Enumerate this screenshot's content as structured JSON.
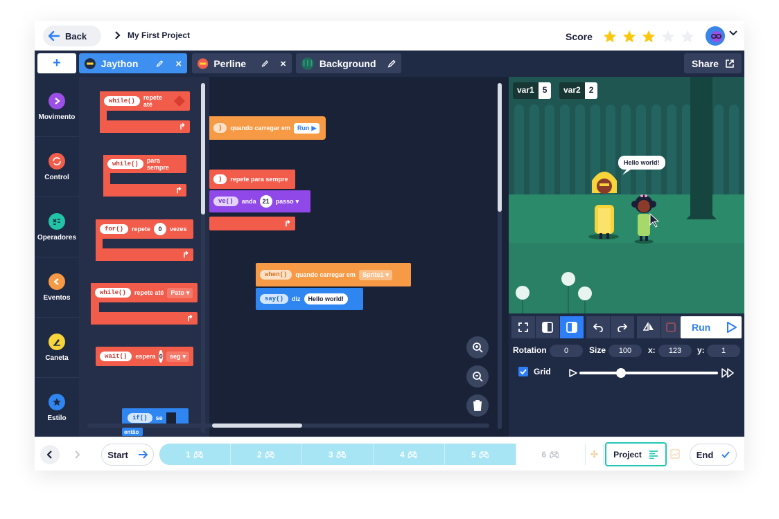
{
  "header": {
    "back_label": "Back",
    "project_title": "My First Project",
    "score_label": "Score",
    "score": 3,
    "score_max": 5
  },
  "tabs": {
    "add_label": "+",
    "items": [
      {
        "label": "Jaython",
        "active": true
      },
      {
        "label": "Perline",
        "active": false
      },
      {
        "label": "Background",
        "active": false
      }
    ],
    "share_label": "Share"
  },
  "categories": [
    {
      "label": "Movimento",
      "color": "#9c4fe6"
    },
    {
      "label": "Control",
      "color": "#f25c4b"
    },
    {
      "label": "Operadores",
      "color": "#21c5a5"
    },
    {
      "label": "Eventos",
      "color": "#f79a45"
    },
    {
      "label": "Caneta",
      "color": "#f7d43a"
    },
    {
      "label": "Estilo",
      "color": "#2f86f0"
    }
  ],
  "palette": {
    "while1": {
      "code": "while()",
      "text": "repete até"
    },
    "while2": {
      "code": "while()",
      "text": "para sempre"
    },
    "for1": {
      "code": "for()",
      "text": "repete",
      "value": "0",
      "suffix": "vezes"
    },
    "while3": {
      "code": "while()",
      "text": "repete até",
      "option": "Pato"
    },
    "wait1": {
      "code": "wait()",
      "text": "espera",
      "value": "0",
      "option": "seg"
    },
    "if1": {
      "code": "if()",
      "text": "se",
      "below": "então"
    }
  },
  "workspace": {
    "b1": {
      "code": ")",
      "text": "quando carregar em",
      "option": "Run"
    },
    "b2": {
      "code": ")",
      "text": "repete para sempre"
    },
    "b3": {
      "code": "ve()",
      "text": "anda",
      "value": "21",
      "option": "passo"
    },
    "b4": {
      "code": "when()",
      "text": "quando carregar em",
      "option": "Sprite1"
    },
    "b5": {
      "code": "say()",
      "text": "diz",
      "value": "Hello world!"
    }
  },
  "stage": {
    "vars": [
      {
        "name": "var1",
        "value": "5"
      },
      {
        "name": "var2",
        "value": "2"
      }
    ],
    "speech": "Hello world!"
  },
  "controls": {
    "run_label": "Run",
    "rotation_label": "Rotation",
    "rotation": "0",
    "size_label": "Size",
    "size": "100",
    "x_label": "x:",
    "x": "123",
    "y_label": "y:",
    "y": "1",
    "grid_label": "Grid",
    "grid_checked": true,
    "speed_level": 0.3
  },
  "bottom": {
    "start_label": "Start",
    "steps": [
      "1",
      "2",
      "3",
      "4",
      "5",
      "6"
    ],
    "project_label": "Project",
    "end_label": "End"
  }
}
